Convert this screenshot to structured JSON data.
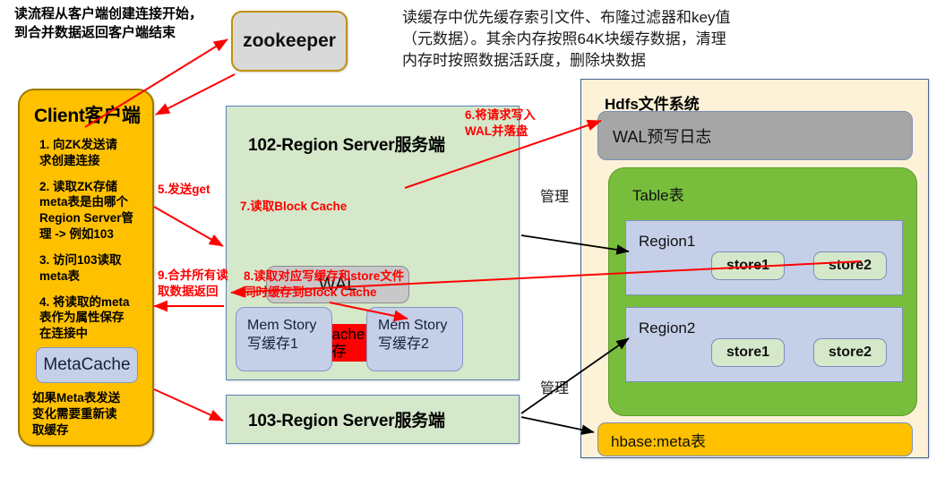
{
  "notes": {
    "flow_note": "读流程从客户端创建连接开始，\n到合并数据返回客户端结束",
    "cache_note": "读缓存中优先缓存索引文件、布隆过滤器和key值\n（元数据）。其余内存按照64K块缓存数据，清理\n内存时按照数据活跃度，删除块数据"
  },
  "zookeeper": {
    "label": "zookeeper"
  },
  "client": {
    "title": "Client客户端",
    "steps": [
      "1. 向ZK发送请\n求创建连接",
      "2. 读取ZK存储\nmeta表是由哪个\nRegion Server管\n理 -> 例如103",
      "3. 访问103读取\nmeta表",
      "4. 将读取的meta\n表作为属性保存\n在连接中"
    ],
    "metacache_label": "MetaCache",
    "footer_note": "如果Meta表发送\n变化需要重新读\n取缓存"
  },
  "region_server_102": {
    "title": "102-Region Server服务端",
    "wal_label": "WAL",
    "block_cache": {
      "line1": "Block cache",
      "line2": "读缓存"
    },
    "memstores": [
      {
        "line1": "Mem Story",
        "line2": "写缓存1"
      },
      {
        "line1": "Mem Story",
        "line2": "写缓存2"
      }
    ]
  },
  "region_server_103": {
    "title": "103-Region Server服务端"
  },
  "hdfs": {
    "title": "Hdfs文件系统",
    "wal_log_label": "WAL预写日志",
    "table_label": "Table表",
    "regions": [
      {
        "name": "Region1",
        "stores": [
          "store1",
          "store2"
        ]
      },
      {
        "name": "Region2",
        "stores": [
          "store1",
          "store2"
        ]
      }
    ],
    "meta_table_label": "hbase:meta表"
  },
  "annotations": {
    "step5": "5.发送get",
    "step6": "6.将请求写入\nWAL并落盘",
    "step7": "7.读取Block Cache",
    "step8": "8.读取对应写缓存和store文件\n同时缓存到Block Cache",
    "step9": "9.合并所有读\n取数据返回",
    "manage_top": "管理",
    "manage_bottom": "管理"
  },
  "colors": {
    "client_fill": "#ffc000",
    "zookeeper_fill": "#d9d9d9",
    "region_server_fill": "#d5e8ca",
    "hdfs_fill": "#fdf2d8",
    "table_fill": "#78be3c",
    "region_fill": "#c5cfe8",
    "block_cache_fill": "#ff0000",
    "wal_fill": "#c8c8c8",
    "red_arrow": "#ff0000",
    "black_arrow": "#000000"
  }
}
